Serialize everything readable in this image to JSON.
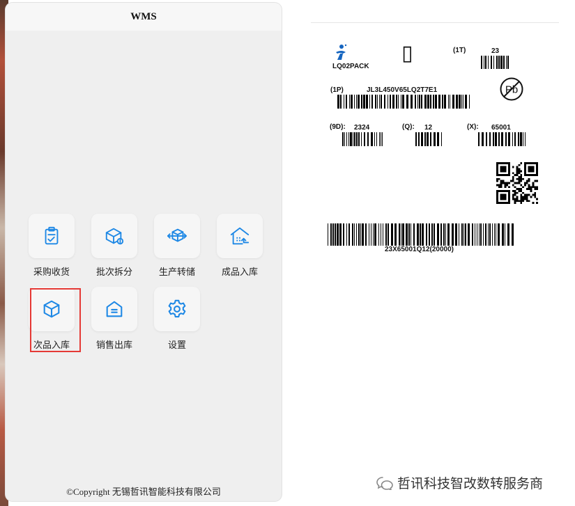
{
  "app": {
    "title": "WMS",
    "menu": [
      {
        "label": "采购收货",
        "icon": "clipboard-check-icon"
      },
      {
        "label": "批次拆分",
        "icon": "box-split-icon"
      },
      {
        "label": "生产转储",
        "icon": "box-transfer-icon"
      },
      {
        "label": "成品入库",
        "icon": "warehouse-in-icon"
      },
      {
        "label": "次品入库",
        "icon": "cube-icon"
      },
      {
        "label": "销售出库",
        "icon": "store-out-icon"
      },
      {
        "label": "设置",
        "icon": "gear-icon"
      }
    ],
    "footer": "©Copyright 无锡哲讯智能科技有限公司",
    "accent_color": "#1e88e5",
    "highlight_color": "#e53935"
  },
  "label": {
    "brand": "LQ02PACK",
    "box_glyph": "▯",
    "t1_code": "(1T)",
    "t1_value": "23",
    "p1_code": "(1P)",
    "p1_value": "JL3L450V65LQ2T7E1",
    "d9_code": "(9D):",
    "d9_value": "2324",
    "q_code": "(Q):",
    "q_value": "12",
    "x_code": "(X):",
    "x_value": "65001",
    "bottom_text": "23X65001Q12(20000)",
    "pb_mark": "Pb"
  },
  "watermark": {
    "text": "哲讯科技智改数转服务商"
  }
}
